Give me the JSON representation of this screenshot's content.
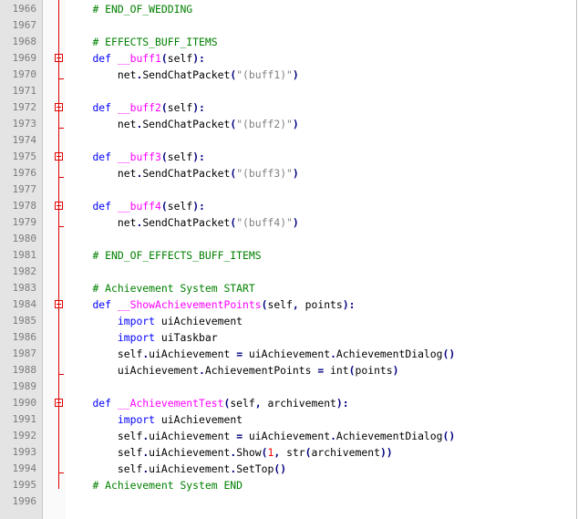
{
  "colors": {
    "keyword": "#0000ff",
    "function_name": "#ff00ff",
    "comment": "#008000",
    "operator": "#000080",
    "string": "#808080",
    "number": "#ff0000",
    "fold_marker": "#e00000",
    "gutter_bg": "#e4e4e4"
  },
  "lines": [
    {
      "num": "1966",
      "indent": "    ",
      "tokens": [
        {
          "t": "# END_OF_WEDDING",
          "c": "cm"
        }
      ]
    },
    {
      "num": "1967",
      "indent": "",
      "tokens": []
    },
    {
      "num": "1968",
      "indent": "    ",
      "tokens": [
        {
          "t": "# EFFECTS_BUFF_ITEMS",
          "c": "cm"
        }
      ]
    },
    {
      "num": "1969",
      "indent": "    ",
      "fold": "start",
      "tokens": [
        {
          "t": "def ",
          "c": "kw"
        },
        {
          "t": "__buff1",
          "c": "fn"
        },
        {
          "t": "(",
          "c": "op"
        },
        {
          "t": "self",
          "c": "pl"
        },
        {
          "t": "):",
          "c": "op"
        }
      ]
    },
    {
      "num": "1970",
      "indent": "        ",
      "fold": "end",
      "tokens": [
        {
          "t": "net",
          "c": "pl"
        },
        {
          "t": ".",
          "c": "op"
        },
        {
          "t": "SendChatPacket",
          "c": "pl"
        },
        {
          "t": "(",
          "c": "op"
        },
        {
          "t": "\"(buff1)\"",
          "c": "st"
        },
        {
          "t": ")",
          "c": "op"
        }
      ]
    },
    {
      "num": "1971",
      "indent": "",
      "tokens": []
    },
    {
      "num": "1972",
      "indent": "    ",
      "fold": "start",
      "tokens": [
        {
          "t": "def ",
          "c": "kw"
        },
        {
          "t": "__buff2",
          "c": "fn"
        },
        {
          "t": "(",
          "c": "op"
        },
        {
          "t": "self",
          "c": "pl"
        },
        {
          "t": "):",
          "c": "op"
        }
      ]
    },
    {
      "num": "1973",
      "indent": "        ",
      "fold": "end",
      "tokens": [
        {
          "t": "net",
          "c": "pl"
        },
        {
          "t": ".",
          "c": "op"
        },
        {
          "t": "SendChatPacket",
          "c": "pl"
        },
        {
          "t": "(",
          "c": "op"
        },
        {
          "t": "\"(buff2)\"",
          "c": "st"
        },
        {
          "t": ")",
          "c": "op"
        }
      ]
    },
    {
      "num": "1974",
      "indent": "",
      "tokens": []
    },
    {
      "num": "1975",
      "indent": "    ",
      "fold": "start",
      "tokens": [
        {
          "t": "def ",
          "c": "kw"
        },
        {
          "t": "__buff3",
          "c": "fn"
        },
        {
          "t": "(",
          "c": "op"
        },
        {
          "t": "self",
          "c": "pl"
        },
        {
          "t": "):",
          "c": "op"
        }
      ]
    },
    {
      "num": "1976",
      "indent": "        ",
      "fold": "end",
      "tokens": [
        {
          "t": "net",
          "c": "pl"
        },
        {
          "t": ".",
          "c": "op"
        },
        {
          "t": "SendChatPacket",
          "c": "pl"
        },
        {
          "t": "(",
          "c": "op"
        },
        {
          "t": "\"(buff3)\"",
          "c": "st"
        },
        {
          "t": ")",
          "c": "op"
        }
      ]
    },
    {
      "num": "1977",
      "indent": "",
      "tokens": []
    },
    {
      "num": "1978",
      "indent": "    ",
      "fold": "start",
      "tokens": [
        {
          "t": "def ",
          "c": "kw"
        },
        {
          "t": "__buff4",
          "c": "fn"
        },
        {
          "t": "(",
          "c": "op"
        },
        {
          "t": "self",
          "c": "pl"
        },
        {
          "t": "):",
          "c": "op"
        }
      ]
    },
    {
      "num": "1979",
      "indent": "        ",
      "fold": "end",
      "tokens": [
        {
          "t": "net",
          "c": "pl"
        },
        {
          "t": ".",
          "c": "op"
        },
        {
          "t": "SendChatPacket",
          "c": "pl"
        },
        {
          "t": "(",
          "c": "op"
        },
        {
          "t": "\"(buff4)\"",
          "c": "st"
        },
        {
          "t": ")",
          "c": "op"
        }
      ]
    },
    {
      "num": "1980",
      "indent": "",
      "tokens": []
    },
    {
      "num": "1981",
      "indent": "    ",
      "tokens": [
        {
          "t": "# END_OF_EFFECTS_BUFF_ITEMS",
          "c": "cm"
        }
      ]
    },
    {
      "num": "1982",
      "indent": "",
      "tokens": []
    },
    {
      "num": "1983",
      "indent": "    ",
      "tokens": [
        {
          "t": "# Achievement System START",
          "c": "cm"
        }
      ]
    },
    {
      "num": "1984",
      "indent": "    ",
      "fold": "start",
      "tokens": [
        {
          "t": "def ",
          "c": "kw"
        },
        {
          "t": "__ShowAchievementPoints",
          "c": "fn"
        },
        {
          "t": "(",
          "c": "op"
        },
        {
          "t": "self",
          "c": "pl"
        },
        {
          "t": ", ",
          "c": "op"
        },
        {
          "t": "points",
          "c": "pl"
        },
        {
          "t": "):",
          "c": "op"
        }
      ]
    },
    {
      "num": "1985",
      "indent": "        ",
      "tokens": [
        {
          "t": "import ",
          "c": "kw"
        },
        {
          "t": "uiAchievement",
          "c": "pl"
        }
      ]
    },
    {
      "num": "1986",
      "indent": "        ",
      "tokens": [
        {
          "t": "import ",
          "c": "kw"
        },
        {
          "t": "uiTaskbar",
          "c": "pl"
        }
      ]
    },
    {
      "num": "1987",
      "indent": "        ",
      "tokens": [
        {
          "t": "self",
          "c": "pl"
        },
        {
          "t": ".",
          "c": "op"
        },
        {
          "t": "uiAchievement ",
          "c": "pl"
        },
        {
          "t": "= ",
          "c": "op"
        },
        {
          "t": "uiAchievement",
          "c": "pl"
        },
        {
          "t": ".",
          "c": "op"
        },
        {
          "t": "AchievementDialog",
          "c": "pl"
        },
        {
          "t": "()",
          "c": "op"
        }
      ]
    },
    {
      "num": "1988",
      "indent": "        ",
      "fold": "end",
      "tokens": [
        {
          "t": "uiAchievement",
          "c": "pl"
        },
        {
          "t": ".",
          "c": "op"
        },
        {
          "t": "AchievementPoints ",
          "c": "pl"
        },
        {
          "t": "= ",
          "c": "op"
        },
        {
          "t": "int",
          "c": "pl"
        },
        {
          "t": "(",
          "c": "op"
        },
        {
          "t": "points",
          "c": "pl"
        },
        {
          "t": ")",
          "c": "op"
        }
      ]
    },
    {
      "num": "1989",
      "indent": "",
      "tokens": []
    },
    {
      "num": "1990",
      "indent": "    ",
      "fold": "start",
      "tokens": [
        {
          "t": "def ",
          "c": "kw"
        },
        {
          "t": "__AchievementTest",
          "c": "fn"
        },
        {
          "t": "(",
          "c": "op"
        },
        {
          "t": "self",
          "c": "pl"
        },
        {
          "t": ", ",
          "c": "op"
        },
        {
          "t": "archivement",
          "c": "pl"
        },
        {
          "t": "):",
          "c": "op"
        }
      ]
    },
    {
      "num": "1991",
      "indent": "        ",
      "tokens": [
        {
          "t": "import ",
          "c": "kw"
        },
        {
          "t": "uiAchievement",
          "c": "pl"
        }
      ]
    },
    {
      "num": "1992",
      "indent": "        ",
      "tokens": [
        {
          "t": "self",
          "c": "pl"
        },
        {
          "t": ".",
          "c": "op"
        },
        {
          "t": "uiAchievement ",
          "c": "pl"
        },
        {
          "t": "= ",
          "c": "op"
        },
        {
          "t": "uiAchievement",
          "c": "pl"
        },
        {
          "t": ".",
          "c": "op"
        },
        {
          "t": "AchievementDialog",
          "c": "pl"
        },
        {
          "t": "()",
          "c": "op"
        }
      ]
    },
    {
      "num": "1993",
      "indent": "        ",
      "tokens": [
        {
          "t": "self",
          "c": "pl"
        },
        {
          "t": ".",
          "c": "op"
        },
        {
          "t": "uiAchievement",
          "c": "pl"
        },
        {
          "t": ".",
          "c": "op"
        },
        {
          "t": "Show",
          "c": "pl"
        },
        {
          "t": "(",
          "c": "op"
        },
        {
          "t": "1",
          "c": "nm"
        },
        {
          "t": ", ",
          "c": "op"
        },
        {
          "t": "str",
          "c": "pl"
        },
        {
          "t": "(",
          "c": "op"
        },
        {
          "t": "archivement",
          "c": "pl"
        },
        {
          "t": "))",
          "c": "op"
        }
      ]
    },
    {
      "num": "1994",
      "indent": "        ",
      "fold": "end",
      "tokens": [
        {
          "t": "self",
          "c": "pl"
        },
        {
          "t": ".",
          "c": "op"
        },
        {
          "t": "uiAchievement",
          "c": "pl"
        },
        {
          "t": ".",
          "c": "op"
        },
        {
          "t": "SetTop",
          "c": "pl"
        },
        {
          "t": "()",
          "c": "op"
        }
      ]
    },
    {
      "num": "1995",
      "indent": "    ",
      "tokens": [
        {
          "t": "# Achievement System END",
          "c": "cm"
        }
      ]
    },
    {
      "num": "1996",
      "indent": "",
      "tokens": []
    }
  ]
}
